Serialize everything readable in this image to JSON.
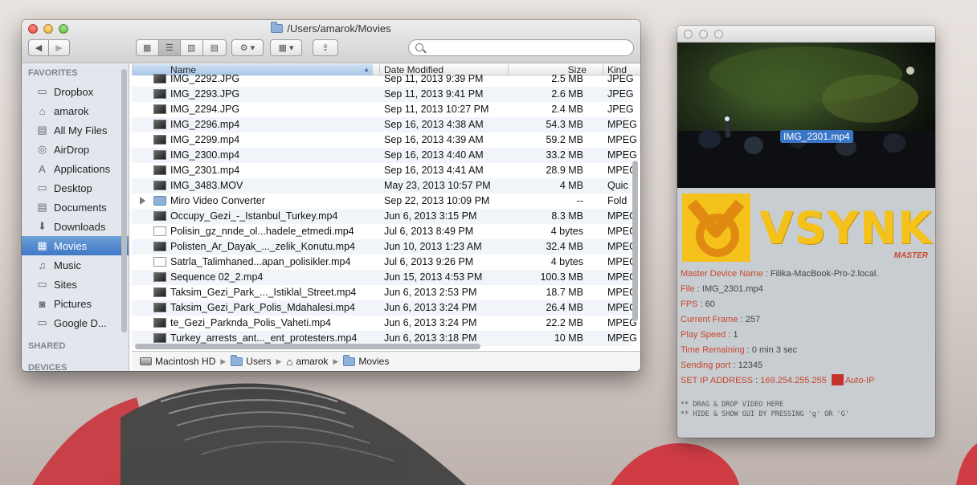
{
  "finder": {
    "title": "/Users/amarok/Movies",
    "sidebar": {
      "favorites_heading": "FAVORITES",
      "shared_heading": "SHARED",
      "devices_heading": "DEVICES",
      "items": [
        {
          "label": "Dropbox",
          "icon": "folder-icon"
        },
        {
          "label": "amarok",
          "icon": "home-icon"
        },
        {
          "label": "All My Files",
          "icon": "all-files-icon"
        },
        {
          "label": "AirDrop",
          "icon": "airdrop-icon"
        },
        {
          "label": "Applications",
          "icon": "applications-icon"
        },
        {
          "label": "Desktop",
          "icon": "desktop-icon"
        },
        {
          "label": "Documents",
          "icon": "documents-icon"
        },
        {
          "label": "Downloads",
          "icon": "downloads-icon"
        },
        {
          "label": "Movies",
          "icon": "movies-icon",
          "selected": true
        },
        {
          "label": "Music",
          "icon": "music-icon"
        },
        {
          "label": "Sites",
          "icon": "folder-icon"
        },
        {
          "label": "Pictures",
          "icon": "camera-icon"
        },
        {
          "label": "Google D...",
          "icon": "folder-icon"
        }
      ]
    },
    "columns": {
      "name": "Name",
      "date": "Date Modified",
      "size": "Size",
      "kind": "Kind"
    },
    "rows": [
      {
        "name": "IMG_2292.JPG",
        "date": "Sep 11, 2013 9:39 PM",
        "size": "2.5 MB",
        "kind": "JPEG",
        "type": "image"
      },
      {
        "name": "IMG_2293.JPG",
        "date": "Sep 11, 2013 9:41 PM",
        "size": "2.6 MB",
        "kind": "JPEG",
        "type": "image"
      },
      {
        "name": "IMG_2294.JPG",
        "date": "Sep 11, 2013 10:27 PM",
        "size": "2.4 MB",
        "kind": "JPEG",
        "type": "image"
      },
      {
        "name": "IMG_2296.mp4",
        "date": "Sep 16, 2013 4:38 AM",
        "size": "54.3 MB",
        "kind": "MPEG",
        "type": "video"
      },
      {
        "name": "IMG_2299.mp4",
        "date": "Sep 16, 2013 4:39 AM",
        "size": "59.2 MB",
        "kind": "MPEG",
        "type": "video"
      },
      {
        "name": "IMG_2300.mp4",
        "date": "Sep 16, 2013 4:40 AM",
        "size": "33.2 MB",
        "kind": "MPEG",
        "type": "video"
      },
      {
        "name": "IMG_2301.mp4",
        "date": "Sep 16, 2013 4:41 AM",
        "size": "28.9 MB",
        "kind": "MPEG",
        "type": "video"
      },
      {
        "name": "IMG_3483.MOV",
        "date": "May 23, 2013 10:57 PM",
        "size": "4 MB",
        "kind": "Quic",
        "type": "video"
      },
      {
        "name": "Miro Video Converter",
        "date": "Sep 22, 2013 10:09 PM",
        "size": "--",
        "kind": "Fold",
        "type": "folder"
      },
      {
        "name": "Occupy_Gezi_-_Istanbul_Turkey.mp4",
        "date": "Jun 6, 2013 3:15 PM",
        "size": "8.3 MB",
        "kind": "MPEG",
        "type": "video"
      },
      {
        "name": "Polisin_gz_nnde_ol...hadele_etmedi.mp4",
        "date": "Jul 6, 2013 8:49 PM",
        "size": "4 bytes",
        "kind": "MPEG",
        "type": "doc"
      },
      {
        "name": "Polisten_Ar_Dayak_..._zelik_Konutu.mp4",
        "date": "Jun 10, 2013 1:23 AM",
        "size": "32.4 MB",
        "kind": "MPEG",
        "type": "video"
      },
      {
        "name": "Satrla_Talimhaned...apan_polisikler.mp4",
        "date": "Jul 6, 2013 9:26 PM",
        "size": "4 bytes",
        "kind": "MPEG",
        "type": "doc"
      },
      {
        "name": "Sequence 02_2.mp4",
        "date": "Jun 15, 2013 4:53 PM",
        "size": "100.3 MB",
        "kind": "MPEG",
        "type": "video"
      },
      {
        "name": "Taksim_Gezi_Park_..._Istiklal_Street.mp4",
        "date": "Jun 6, 2013 2:53 PM",
        "size": "18.7 MB",
        "kind": "MPEG",
        "type": "video"
      },
      {
        "name": "Taksim_Gezi_Park_Polis_Mdahalesi.mp4",
        "date": "Jun 6, 2013 3:24 PM",
        "size": "26.4 MB",
        "kind": "MPEG",
        "type": "video"
      },
      {
        "name": "te_Gezi_Parknda_Polis_Vaheti.mp4",
        "date": "Jun 6, 2013 3:24 PM",
        "size": "22.2 MB",
        "kind": "MPEG",
        "type": "video"
      },
      {
        "name": "Turkey_arrests_ant..._ent_protesters.mp4",
        "date": "Jun 6, 2013 3:18 PM",
        "size": "10 MB",
        "kind": "MPEG",
        "type": "video"
      }
    ],
    "path": [
      "Macintosh HD",
      "Users",
      "amarok",
      "Movies"
    ]
  },
  "vsynk": {
    "video_label": "IMG_2301.mp4",
    "brand": "VSYNK",
    "mode": "MASTER",
    "fields": [
      {
        "key": "Master Device Name",
        "value": "Filika-MacBook-Pro-2.local."
      },
      {
        "key": "File",
        "value": "IMG_2301.mp4"
      },
      {
        "key": "FPS",
        "value": "60"
      },
      {
        "key": "Current Frame",
        "value": "257"
      },
      {
        "key": "Play Speed",
        "value": "1"
      },
      {
        "key": "Time Remaining",
        "value": "0 min 3 sec"
      },
      {
        "key": "Sending port",
        "value": "12345"
      }
    ],
    "set_ip_label": "SET IP ADDRESS",
    "ip": "169.254.255.255",
    "auto_ip": "Auto-IP",
    "hint1": "** DRAG & DROP VIDEO HERE",
    "hint2": "** HIDE & SHOW GUI BY PRESSING 'g' OR 'G'",
    "accent": "#c8462c",
    "brand_color": "#f4c21b"
  }
}
